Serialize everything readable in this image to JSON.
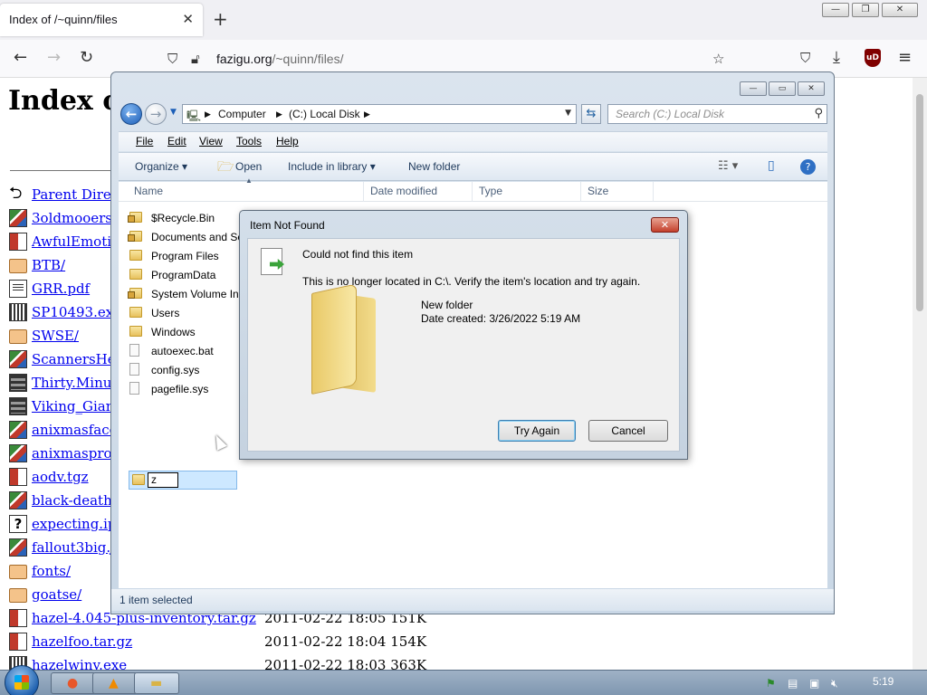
{
  "browser": {
    "tab_title": "Index of /~quinn/files",
    "tab_close": "✕",
    "new_tab": "+",
    "url_host": "fazigu.org",
    "url_path": "/~quinn/files/",
    "back_glyph": "←",
    "forward_glyph": "→",
    "reload_glyph": "↻",
    "bookmark_glyph": "☆",
    "pocket_glyph": "⛉",
    "download_glyph": "⤓",
    "menu_glyph": "≡",
    "ublock_label": "uD",
    "window_buttons": [
      "—",
      "❐",
      "✕"
    ]
  },
  "listing": {
    "heading": "Index of",
    "rows": [
      {
        "name": "Parent Directo",
        "icon": "back-icon",
        "meta": ""
      },
      {
        "name": "3oldmooers.jp",
        "icon": "image-icon",
        "meta": ""
      },
      {
        "name": "AwfulEmoticc",
        "icon": "archive-icon",
        "meta": ""
      },
      {
        "name": "BTB/",
        "icon": "folder-icon",
        "meta": ""
      },
      {
        "name": "GRR.pdf",
        "icon": "document-icon",
        "meta": ""
      },
      {
        "name": "SP10493.exe",
        "icon": "binary-icon",
        "meta": ""
      },
      {
        "name": "SWSE/",
        "icon": "folder-icon",
        "meta": ""
      },
      {
        "name": "ScannersHead",
        "icon": "image-icon",
        "meta": ""
      },
      {
        "name": "Thirty.Minute",
        "icon": "movie-icon",
        "meta": ""
      },
      {
        "name": "Viking_Giant",
        "icon": "movie-icon",
        "meta": ""
      },
      {
        "name": "anixmasface.j",
        "icon": "image-icon",
        "meta": ""
      },
      {
        "name": "anixmasprofil",
        "icon": "image-icon",
        "meta": ""
      },
      {
        "name": "aodv.tgz",
        "icon": "archive-icon",
        "meta": ""
      },
      {
        "name": "black-death-p",
        "icon": "image-icon",
        "meta": ""
      },
      {
        "name": "expecting.ipk",
        "icon": "unknown-icon",
        "meta": ""
      },
      {
        "name": "fallout3big.jp",
        "icon": "image-icon",
        "meta": ""
      },
      {
        "name": "fonts/",
        "icon": "folder-icon",
        "meta": ""
      },
      {
        "name": "goatse/",
        "icon": "folder-icon",
        "meta": ""
      },
      {
        "name": "hazel-4.045-plus-inventory.tar.gz",
        "icon": "archive-icon",
        "meta": "2011-02-22 18:05 151K"
      },
      {
        "name": "hazelfoo.tar.gz",
        "icon": "archive-icon",
        "meta": "2011-02-22 18:04 154K"
      },
      {
        "name": "hazelwinv.exe",
        "icon": "binary-icon",
        "meta": "2011-02-22 18:03 363K"
      }
    ]
  },
  "explorer": {
    "caption_buttons": [
      "—",
      "▭",
      "✕"
    ],
    "breadcrumbs": [
      "Computer",
      "(C:) Local Disk"
    ],
    "search_placeholder": "Search (C:) Local Disk",
    "menu": [
      {
        "label": "File",
        "key": "F"
      },
      {
        "label": "Edit",
        "key": "E"
      },
      {
        "label": "View",
        "key": "V"
      },
      {
        "label": "Tools",
        "key": "T"
      },
      {
        "label": "Help",
        "key": "H"
      }
    ],
    "commands": {
      "organize": "Organize ▾",
      "open": "Open",
      "include": "Include in library ▾",
      "new_folder": "New folder"
    },
    "columns": [
      "Name",
      "Date modified",
      "Type",
      "Size"
    ],
    "files": [
      {
        "name": "$Recycle.Bin",
        "kind": "folder-locked"
      },
      {
        "name": "Documents and Se",
        "kind": "folder-locked"
      },
      {
        "name": "Program Files",
        "kind": "folder"
      },
      {
        "name": "ProgramData",
        "kind": "folder"
      },
      {
        "name": "System Volume In",
        "kind": "folder-locked"
      },
      {
        "name": "Users",
        "kind": "folder"
      },
      {
        "name": "Windows",
        "kind": "folder"
      },
      {
        "name": "autoexec.bat",
        "kind": "file"
      },
      {
        "name": "config.sys",
        "kind": "file"
      },
      {
        "name": "pagefile.sys",
        "kind": "file"
      }
    ],
    "renaming_value": "z",
    "status": "1 item selected"
  },
  "dialog": {
    "title": "Item Not Found",
    "close": "✕",
    "heading": "Could not find this item",
    "message": "This is no longer located in C:\\. Verify the item's location and try again.",
    "item_name": "New folder",
    "item_date": "Date created: 3/26/2022 5:19 AM",
    "try_again": "Try Again",
    "cancel": "Cancel"
  },
  "taskbar": {
    "clock": "5:19"
  }
}
